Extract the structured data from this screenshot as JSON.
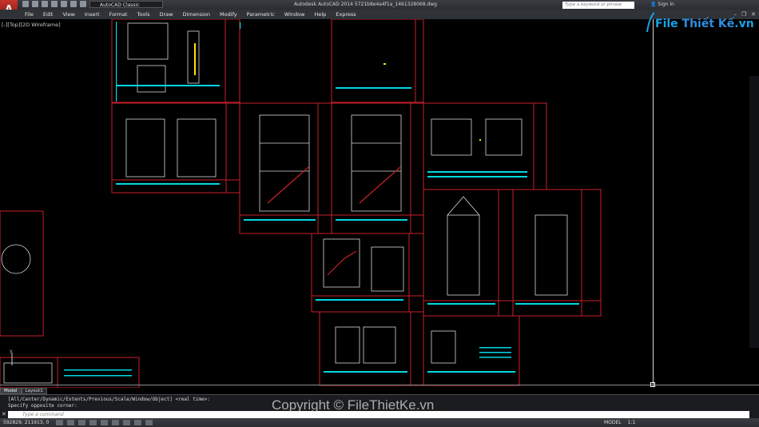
{
  "app": {
    "window_title": "Autodesk AutoCAD 2014    5721b8e4a4f1a_1461328068.dwg",
    "app_button": "A",
    "workspace": "AutoCAD Classic",
    "search_placeholder": "Type a keyword or phrase",
    "sign_in": "Sign In"
  },
  "menu": [
    "File",
    "Edit",
    "View",
    "Insert",
    "Format",
    "Tools",
    "Draw",
    "Dimension",
    "Modify",
    "Parametric",
    "Window",
    "Help",
    "Express"
  ],
  "viewport": {
    "label": "[-][Top][2D Wireframe]"
  },
  "logo": {
    "part1": "File",
    "part2": "Thiết Kế",
    "part3": ".vn"
  },
  "tabs": [
    "Model",
    "Layout1"
  ],
  "command": {
    "history1": "[All/Center/Dynamic/Extents/Previous/Scale/Window/Object] <real time>:",
    "history2": "Specify opposite corner:",
    "placeholder": "Type a command",
    "close": "✕"
  },
  "status": {
    "coords": "592829, 211913, 0",
    "model": "MODEL",
    "scale": "1:1"
  },
  "watermark": "Copyright © FileThietKe.vn",
  "colors": {
    "accent": "#17a3e6",
    "drawing_red": "#c8202a",
    "drawing_cyan": "#00ffff"
  }
}
